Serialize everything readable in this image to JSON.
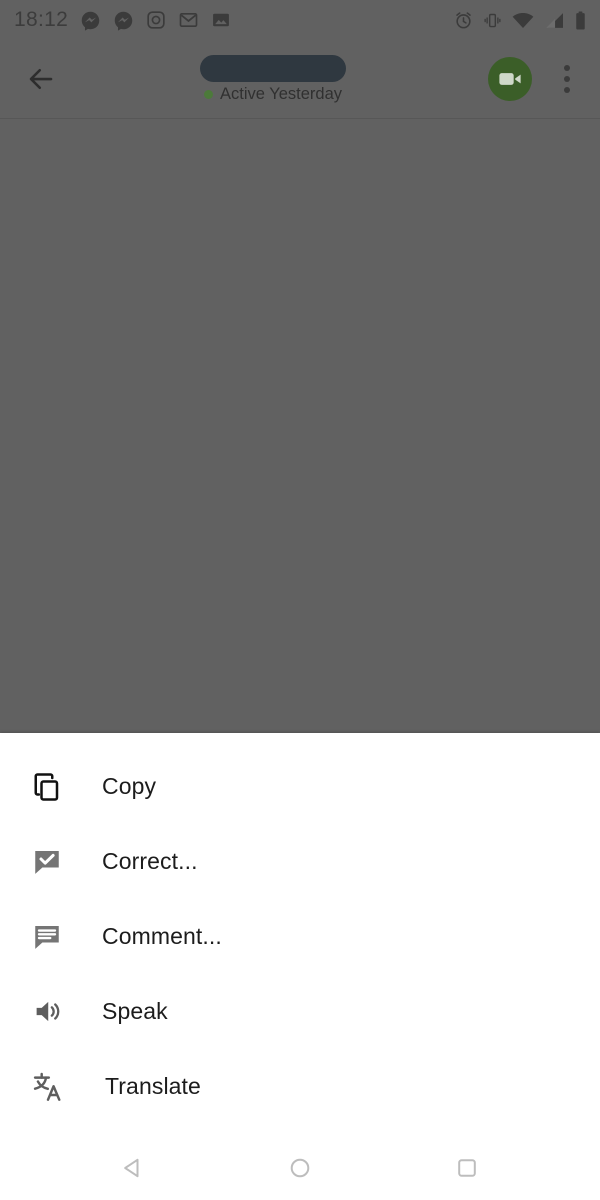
{
  "status_bar": {
    "clock": "18:12",
    "left_icons": [
      "messenger-icon",
      "messenger-icon",
      "instagram-icon",
      "gmail-icon",
      "photos-icon"
    ],
    "right_icons": [
      "alarm-icon",
      "vibrate-icon",
      "wifi-icon",
      "cellular-signal-icon",
      "battery-icon"
    ]
  },
  "toolbar": {
    "back_icon": "back-arrow-icon",
    "contact_name": "",
    "presence_text": "Active Yesterday",
    "presence_color": "#4c7a3a",
    "video_call_icon": "video-camera-icon",
    "video_call_bg": "#3b5e28",
    "overflow_icon": "more-vertical-icon"
  },
  "context_menu": {
    "background": "#ffffff",
    "items": [
      {
        "label": "Copy",
        "icon": "copy-icon"
      },
      {
        "label": "Correct...",
        "icon": "spellcheck-bubble-icon"
      },
      {
        "label": "Comment...",
        "icon": "comment-bubble-icon"
      },
      {
        "label": "Speak",
        "icon": "speaker-icon"
      },
      {
        "label": "Translate",
        "icon": "translate-icon"
      }
    ]
  },
  "nav_bar": {
    "back_label": "back-triangle-icon",
    "home_label": "home-circle-icon",
    "recents_label": "recents-square-icon"
  },
  "colors": {
    "scrim": "#616161",
    "redaction": "#2f3840",
    "menu_text": "#1c1c1c"
  }
}
